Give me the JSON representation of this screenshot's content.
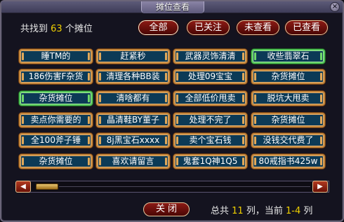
{
  "window": {
    "title": "摊位查看",
    "close_icon": "×"
  },
  "header": {
    "found_prefix": "共找到",
    "found_count": "63",
    "found_suffix": "个摊位"
  },
  "filters": [
    {
      "label": "全部",
      "active": true
    },
    {
      "label": "已关注",
      "active": false
    },
    {
      "label": "未查看",
      "active": false
    },
    {
      "label": "已查看",
      "active": false
    }
  ],
  "stalls": [
    {
      "name": "睡TM的",
      "selected": false
    },
    {
      "name": "赶紧秒",
      "selected": false
    },
    {
      "name": "武器灵饰清清",
      "selected": false
    },
    {
      "name": "收些翡翠石",
      "selected": true
    },
    {
      "name": "186伤害F杂货",
      "selected": false
    },
    {
      "name": "清理各种BB装",
      "selected": false
    },
    {
      "name": "处理09宝宝",
      "selected": false
    },
    {
      "name": "杂货摊位",
      "selected": false
    },
    {
      "name": "杂货摊位",
      "selected": true
    },
    {
      "name": "清啥都有",
      "selected": false
    },
    {
      "name": "全部低价甩卖",
      "selected": false
    },
    {
      "name": "脱坑大甩卖",
      "selected": false
    },
    {
      "name": "卖点你需要的",
      "selected": false
    },
    {
      "name": "晶清鞋BY董子",
      "selected": false
    },
    {
      "name": "处理不完了",
      "selected": false
    },
    {
      "name": "杂货摊位",
      "selected": false
    },
    {
      "name": "全100斧子锤",
      "selected": false
    },
    {
      "name": "8j黑宝石xxxx",
      "selected": false
    },
    {
      "name": "卖个宝石钱",
      "selected": false
    },
    {
      "name": "没钱交代费了",
      "selected": false
    },
    {
      "name": "杂货摊位",
      "selected": false
    },
    {
      "name": "喜欢请留言",
      "selected": false
    },
    {
      "name": "鬼套1Q神1Q5",
      "selected": false
    },
    {
      "name": "80戒指书425w",
      "selected": false
    }
  ],
  "scrollbar": {
    "left_icon": "◀",
    "right_icon": "▶",
    "thumb_icon": "|||"
  },
  "footer": {
    "close_label": "关闭",
    "total_prefix": "总共",
    "total_columns": "11",
    "total_suffix": "列，当前",
    "current_range": "1-4",
    "current_suffix": "列"
  }
}
